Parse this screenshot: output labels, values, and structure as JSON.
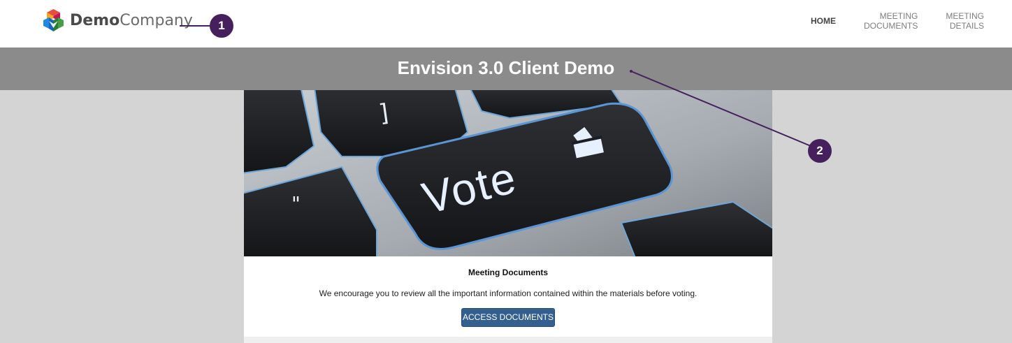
{
  "brand": {
    "name_bold": "Demo",
    "name_light": "Company",
    "logo_icon": "cube-logo-icon"
  },
  "nav": {
    "items": [
      {
        "label": "HOME",
        "active": true
      },
      {
        "label_line1": "MEETING",
        "label_line2": "DOCUMENTS"
      },
      {
        "label_line1": "MEETING",
        "label_line2": "DETAILS"
      }
    ]
  },
  "banner": {
    "title": "Envision 3.0 Client Demo"
  },
  "hero": {
    "key_text": "Vote",
    "icon": "ballot-box-icon"
  },
  "section": {
    "heading": "Meeting Documents",
    "text": "We encourage you to review all the important information contained within the materials before voting.",
    "button_label": "ACCESS DOCUMENTS"
  },
  "callouts": [
    "1",
    "2"
  ],
  "colors": {
    "banner": "#8b8b8b",
    "button": "#33608f",
    "callout": "#45205c",
    "background": "#d3d4d3"
  }
}
